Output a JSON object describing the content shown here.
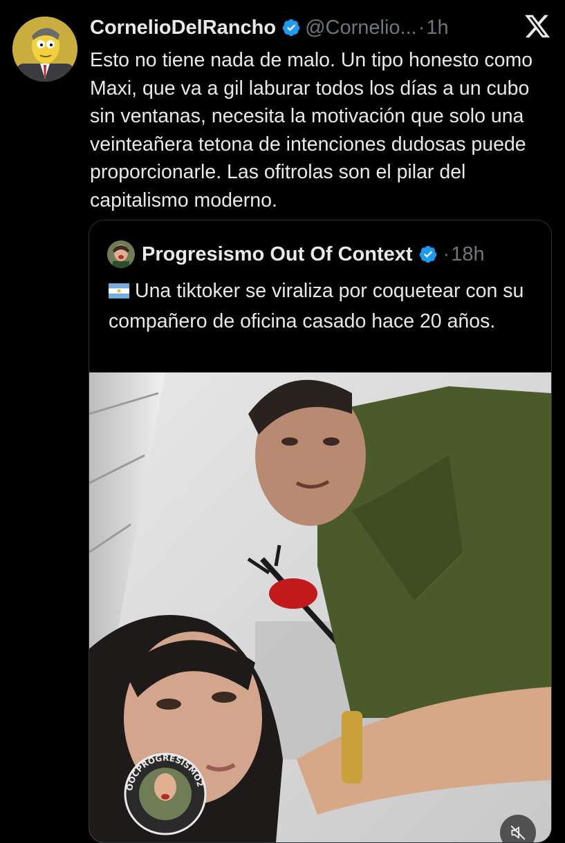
{
  "tweet": {
    "author_name": "CornelioDelRancho",
    "handle": "@Cornelio...",
    "separator": "·",
    "time": "1h",
    "text": "Esto no tiene nada de malo. Un tipo honesto como Maxi, que va a gil laburar todos los días a un cubo sin ventanas, necesita la motivación que solo una veinteañera tetona de intenciones dudosas puede proporcionarle. Las ofitrolas son el pilar del capitalismo moderno."
  },
  "quoted_tweet": {
    "author_name": "Progresismo Out Of Context",
    "separator": "·",
    "time": "18h",
    "text": "Una tiktoker se viraliza por coquetear con su compañero de oficina casado hace 20 años.",
    "watermark": "OOCPROGRESISMO2"
  },
  "icons": {
    "verified": "verified-badge-icon",
    "x_logo": "x-logo-icon",
    "flag": "argentina-flag-icon",
    "mute": "mute-icon"
  },
  "colors": {
    "background": "#000000",
    "text": "#e7e9ea",
    "muted": "#71767b",
    "verified": "#1d9bf0",
    "border": "#2f3336"
  }
}
